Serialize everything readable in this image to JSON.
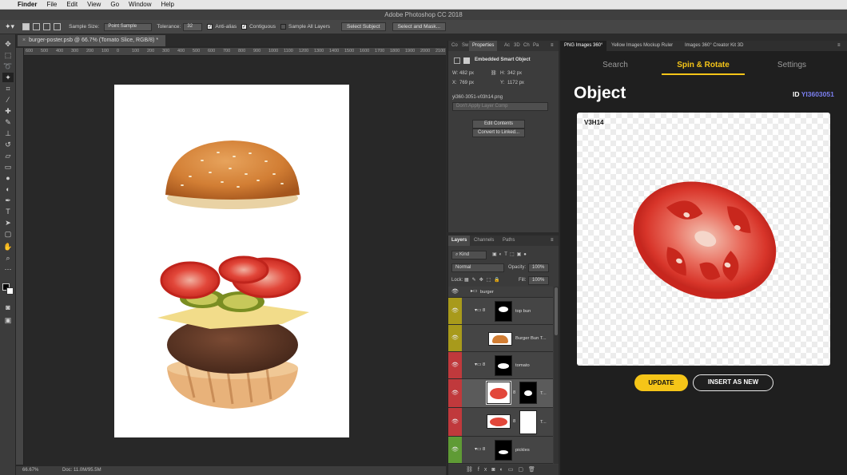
{
  "menubar": {
    "app": "Finder",
    "items": [
      "File",
      "Edit",
      "View",
      "Go",
      "Window",
      "Help"
    ]
  },
  "app_title": "Adobe Photoshop CC 2018",
  "options_bar": {
    "sample_size_label": "Sample Size:",
    "sample_size_value": "Point Sample",
    "tolerance_label": "Tolerance:",
    "tolerance_value": "32",
    "anti_alias": "Anti-alias",
    "contiguous": "Contiguous",
    "sample_all_layers": "Sample All Layers",
    "select_subject": "Select Subject",
    "select_and_mask": "Select and Mask..."
  },
  "document": {
    "tab_title": "burger-poster.psb @ 66.7% (Tomato Slice, RGB/8) *",
    "ruler_ticks": [
      "600",
      "500",
      "400",
      "300",
      "200",
      "100",
      "0",
      "100",
      "200",
      "300",
      "400",
      "500",
      "600",
      "700",
      "800",
      "900",
      "1000",
      "1100",
      "1200",
      "1300",
      "1400",
      "1500",
      "1600",
      "1700",
      "1800",
      "1900",
      "2000",
      "2100"
    ],
    "zoom": "66.67%",
    "doc_info": "Doc: 11.0M/95.5M"
  },
  "properties": {
    "tabs": [
      "Co",
      "Sw",
      "Properties",
      "Ac",
      "3D",
      "Ch",
      "Pa"
    ],
    "header": "Embedded Smart Object",
    "w_label": "W:",
    "w_value": "482 px",
    "h_label": "H:",
    "h_value": "342 px",
    "x_label": "X:",
    "x_value": "769 px",
    "y_label": "Y:",
    "y_value": "1172 px",
    "filename": "yi360-3051-v03h14.png",
    "layer_comp": "Don't Apply Layer Comp",
    "edit_contents": "Edit Contents",
    "convert_linked": "Convert to Linked..."
  },
  "layers": {
    "tabs": [
      "Layers",
      "Channels",
      "Paths"
    ],
    "filter_kind": "Kind",
    "blend_mode": "Normal",
    "opacity_label": "Opacity:",
    "opacity_value": "100%",
    "lock_label": "Lock:",
    "fill_label": "Fill:",
    "fill_value": "100%",
    "rows": [
      {
        "name": "burger",
        "color": "#454545"
      },
      {
        "name": "top bun",
        "color": "#a89a1b"
      },
      {
        "name": "Burger Bun T...",
        "color": "#a89a1b"
      },
      {
        "name": "tomato",
        "color": "#c0393c"
      },
      {
        "name": "T...",
        "color": "#c0393c"
      },
      {
        "name": "T...",
        "color": "#c0393c"
      },
      {
        "name": "pickles",
        "color": "#5f9b35"
      }
    ]
  },
  "plugin": {
    "tabs": [
      "PNG Images 360°",
      "Yellow Images Mockup Ruler",
      "Images 360° Creator Kit 3D"
    ],
    "nav": [
      "Search",
      "Spin & Rotate",
      "Settings"
    ],
    "heading": "Object",
    "id_label": "ID",
    "id_value": "YI3603051",
    "card_label": "V3H14",
    "update": "UPDATE",
    "insert": "INSERT AS NEW",
    "accent": "#f5c518",
    "id_color": "#7b7ff0"
  }
}
